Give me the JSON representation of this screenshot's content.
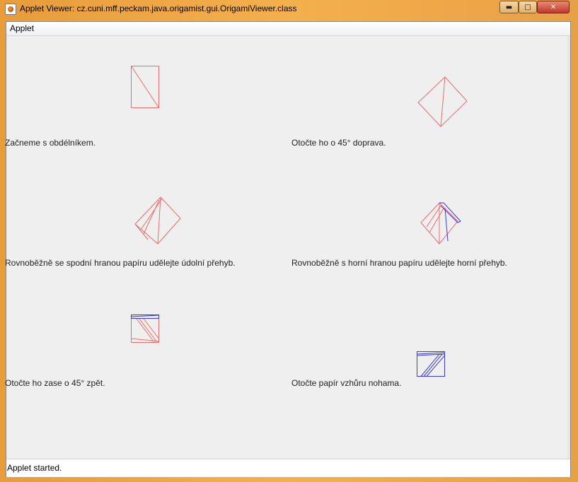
{
  "window": {
    "title": "Applet Viewer: cz.cuni.mff.peckam.java.origamist.gui.OrigamiViewer.class",
    "minimize_glyph": "▬",
    "maximize_glyph": "□",
    "close_glyph": "✕"
  },
  "menubar": {
    "items": [
      "Applet"
    ]
  },
  "steps": [
    {
      "caption": "Začneme s obdélníkem.",
      "icon": "rectangle-diagonal-diagram"
    },
    {
      "caption": "Otočte ho o 45° doprava.",
      "icon": "rotated-rectangle-diagram"
    },
    {
      "caption": "Rovnoběžně se spodní hranou papíru udělejte údolní přehyb.",
      "icon": "valley-fold-diagram"
    },
    {
      "caption": "Rovnoběžně s horní hranou papíru udělejte horní přehyb.",
      "icon": "mountain-fold-diagram"
    },
    {
      "caption": "Otočte ho zase o 45° zpět.",
      "icon": "rotate-back-diagram"
    },
    {
      "caption": "Otočte papír vzhůru nohama.",
      "icon": "flip-paper-diagram"
    }
  ],
  "colors": {
    "front_line": "#ef6b6b",
    "back_line": "#3a3ad6",
    "panel_bg": "#efefef"
  },
  "status": {
    "text": "Applet started."
  }
}
